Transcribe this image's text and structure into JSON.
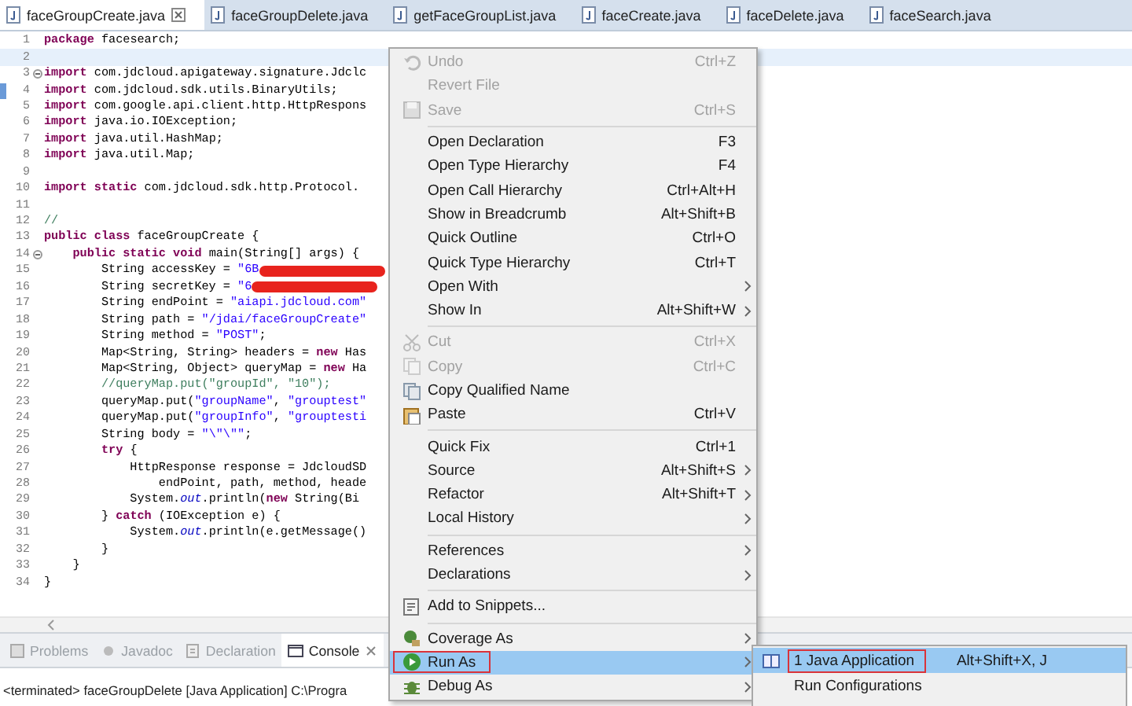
{
  "editor_tabs": [
    {
      "label": "faceGroupCreate.java",
      "selected": true
    },
    {
      "label": "faceGroupDelete.java",
      "selected": false
    },
    {
      "label": "getFaceGroupList.java",
      "selected": false
    },
    {
      "label": "faceCreate.java",
      "selected": false
    },
    {
      "label": "faceDelete.java",
      "selected": false
    },
    {
      "label": "faceSearch.java",
      "selected": false
    }
  ],
  "code_lines": [
    {
      "number": "1",
      "segments": [
        {
          "kind": "keyword",
          "text": "package"
        },
        {
          "kind": "plain",
          "text": " facesearch;"
        }
      ]
    },
    {
      "number": "2",
      "current": true
    },
    {
      "number": "3",
      "fold": true,
      "segments": [
        {
          "kind": "keyword",
          "text": "import"
        },
        {
          "kind": "plain",
          "text": " com.jdcloud.apigateway.signature.Jdclc"
        }
      ]
    },
    {
      "number": "4",
      "marker": true,
      "segments": [
        {
          "kind": "keyword",
          "text": "import"
        },
        {
          "kind": "plain",
          "text": " com.jdcloud.sdk.utils.BinaryUtils;"
        }
      ]
    },
    {
      "number": "5",
      "segments": [
        {
          "kind": "keyword",
          "text": "import"
        },
        {
          "kind": "plain",
          "text": " com.google.api.client.http.HttpRespons"
        }
      ]
    },
    {
      "number": "6",
      "segments": [
        {
          "kind": "keyword",
          "text": "import"
        },
        {
          "kind": "plain",
          "text": " java.io.IOException;"
        }
      ]
    },
    {
      "number": "7",
      "segments": [
        {
          "kind": "keyword",
          "text": "import"
        },
        {
          "kind": "plain",
          "text": " java.util.HashMap;"
        }
      ]
    },
    {
      "number": "8",
      "segments": [
        {
          "kind": "keyword",
          "text": "import"
        },
        {
          "kind": "plain",
          "text": " java.util.Map;"
        }
      ]
    },
    {
      "number": "9"
    },
    {
      "number": "10",
      "segments": [
        {
          "kind": "keyword",
          "text": "import static"
        },
        {
          "kind": "plain",
          "text": " com.jdcloud.sdk.http.Protocol."
        }
      ]
    },
    {
      "number": "11"
    },
    {
      "number": "12",
      "segments": [
        {
          "kind": "comment",
          "text": "//"
        }
      ]
    },
    {
      "number": "13",
      "segments": [
        {
          "kind": "keyword",
          "text": "public class"
        },
        {
          "kind": "plain",
          "text": " faceGroupCreate {"
        }
      ]
    },
    {
      "number": "14",
      "fold": true,
      "segments": [
        {
          "kind": "keyword",
          "text": "    public static void"
        },
        {
          "kind": "plain",
          "text": " main(String[] args) {"
        }
      ]
    },
    {
      "number": "15",
      "segments": [
        {
          "kind": "plain",
          "text": "        String accessKey = "
        },
        {
          "kind": "string",
          "text": "\"6B"
        },
        {
          "kind": "redacted"
        }
      ]
    },
    {
      "number": "16",
      "segments": [
        {
          "kind": "plain",
          "text": "        String secretKey = "
        },
        {
          "kind": "string",
          "text": "\"6"
        },
        {
          "kind": "redacted"
        }
      ]
    },
    {
      "number": "17",
      "segments": [
        {
          "kind": "plain",
          "text": "        String endPoint = "
        },
        {
          "kind": "string",
          "text": "\"aiapi.jdcloud.com\""
        }
      ]
    },
    {
      "number": "18",
      "segments": [
        {
          "kind": "plain",
          "text": "        String path = "
        },
        {
          "kind": "string",
          "text": "\"/jdai/faceGroupCreate\""
        }
      ]
    },
    {
      "number": "19",
      "segments": [
        {
          "kind": "plain",
          "text": "        String method = "
        },
        {
          "kind": "string",
          "text": "\"POST\""
        },
        {
          "kind": "plain",
          "text": ";"
        }
      ]
    },
    {
      "number": "20",
      "segments": [
        {
          "kind": "plain",
          "text": "        Map<String, String> headers = "
        },
        {
          "kind": "keyword",
          "text": "new"
        },
        {
          "kind": "plain",
          "text": " Has"
        }
      ]
    },
    {
      "number": "21",
      "segments": [
        {
          "kind": "plain",
          "text": "        Map<String, Object> queryMap = "
        },
        {
          "kind": "keyword",
          "text": "new"
        },
        {
          "kind": "plain",
          "text": " Ha"
        }
      ]
    },
    {
      "number": "22",
      "segments": [
        {
          "kind": "comment",
          "text": "        //queryMap.put(\"groupId\", \"10\");"
        }
      ]
    },
    {
      "number": "23",
      "segments": [
        {
          "kind": "plain",
          "text": "        queryMap.put("
        },
        {
          "kind": "string",
          "text": "\"groupName\""
        },
        {
          "kind": "plain",
          "text": ", "
        },
        {
          "kind": "string",
          "text": "\"grouptest\""
        }
      ]
    },
    {
      "number": "24",
      "segments": [
        {
          "kind": "plain",
          "text": "        queryMap.put("
        },
        {
          "kind": "string",
          "text": "\"groupInfo\""
        },
        {
          "kind": "plain",
          "text": ", "
        },
        {
          "kind": "string",
          "text": "\"grouptesti"
        }
      ]
    },
    {
      "number": "25",
      "segments": [
        {
          "kind": "plain",
          "text": "        String body = "
        },
        {
          "kind": "string",
          "text": "\"\\\"\\\"\""
        },
        {
          "kind": "plain",
          "text": ";"
        }
      ]
    },
    {
      "number": "26",
      "segments": [
        {
          "kind": "keyword",
          "text": "        try"
        },
        {
          "kind": "plain",
          "text": " {"
        }
      ]
    },
    {
      "number": "27",
      "segments": [
        {
          "kind": "plain",
          "text": "            HttpResponse response = JdcloudSD"
        }
      ]
    },
    {
      "number": "28",
      "segments": [
        {
          "kind": "plain",
          "text": "                endPoint, path, method, heade"
        }
      ]
    },
    {
      "number": "29",
      "segments": [
        {
          "kind": "plain",
          "text": "            System."
        },
        {
          "kind": "field",
          "text": "out"
        },
        {
          "kind": "plain",
          "text": ".println("
        },
        {
          "kind": "keyword",
          "text": "new"
        },
        {
          "kind": "plain",
          "text": " String(Bi"
        }
      ]
    },
    {
      "number": "30",
      "segments": [
        {
          "kind": "plain",
          "text": "        } "
        },
        {
          "kind": "keyword",
          "text": "catch"
        },
        {
          "kind": "plain",
          "text": " (IOException e) {"
        }
      ]
    },
    {
      "number": "31",
      "segments": [
        {
          "kind": "plain",
          "text": "            System."
        },
        {
          "kind": "field",
          "text": "out"
        },
        {
          "kind": "plain",
          "text": ".println(e.getMessage()"
        }
      ]
    },
    {
      "number": "32",
      "segments": [
        {
          "kind": "plain",
          "text": "        }"
        }
      ]
    },
    {
      "number": "33",
      "segments": [
        {
          "kind": "plain",
          "text": "    }"
        }
      ]
    },
    {
      "number": "34",
      "segments": [
        {
          "kind": "plain",
          "text": "}"
        }
      ]
    }
  ],
  "panel_tabs": [
    {
      "label": "Problems",
      "selected": false
    },
    {
      "label": "Javadoc",
      "selected": false
    },
    {
      "label": "Declaration",
      "selected": false
    },
    {
      "label": "Console",
      "selected": true
    }
  ],
  "console": {
    "text": "<terminated> faceGroupDelete [Java Application] C:\\Progra"
  },
  "context_menu": {
    "items": [
      {
        "kind": "item",
        "label": "Undo",
        "shortcut": "Ctrl+Z",
        "disabled": true,
        "selected": false
      },
      {
        "kind": "item",
        "label": "Revert File",
        "disabled": true,
        "selected": false
      },
      {
        "kind": "item",
        "label": "Save",
        "shortcut": "Ctrl+S",
        "disabled": true,
        "selected": false
      },
      {
        "kind": "separator"
      },
      {
        "kind": "item",
        "label": "Open Declaration",
        "shortcut": "F3",
        "disabled": false,
        "selected": false
      },
      {
        "kind": "item",
        "label": "Open Type Hierarchy",
        "shortcut": "F4",
        "disabled": false,
        "selected": false
      },
      {
        "kind": "item",
        "label": "Open Call Hierarchy",
        "shortcut": "Ctrl+Alt+H",
        "disabled": false,
        "selected": false
      },
      {
        "kind": "item",
        "label": "Show in Breadcrumb",
        "shortcut": "Alt+Shift+B",
        "disabled": false,
        "selected": false
      },
      {
        "kind": "item",
        "label": "Quick Outline",
        "shortcut": "Ctrl+O",
        "disabled": false,
        "selected": false
      },
      {
        "kind": "item",
        "label": "Quick Type Hierarchy",
        "shortcut": "Ctrl+T",
        "disabled": false,
        "selected": false
      },
      {
        "kind": "item",
        "label": "Open With",
        "disabled": false,
        "submenu": true,
        "selected": false
      },
      {
        "kind": "item",
        "label": "Show In",
        "shortcut": "Alt+Shift+W",
        "disabled": false,
        "submenu": true,
        "selected": false
      },
      {
        "kind": "separator"
      },
      {
        "kind": "item",
        "label": "Cut",
        "shortcut": "Ctrl+X",
        "disabled": true,
        "selected": false
      },
      {
        "kind": "item",
        "label": "Copy",
        "shortcut": "Ctrl+C",
        "disabled": true,
        "selected": false
      },
      {
        "kind": "item",
        "label": "Copy Qualified Name",
        "disabled": false,
        "selected": false
      },
      {
        "kind": "item",
        "label": "Paste",
        "shortcut": "Ctrl+V",
        "disabled": false,
        "selected": false
      },
      {
        "kind": "separator"
      },
      {
        "kind": "item",
        "label": "Quick Fix",
        "shortcut": "Ctrl+1",
        "disabled": false,
        "selected": false
      },
      {
        "kind": "item",
        "label": "Source",
        "shortcut": "Alt+Shift+S",
        "disabled": false,
        "submenu": true,
        "selected": false
      },
      {
        "kind": "item",
        "label": "Refactor",
        "shortcut": "Alt+Shift+T",
        "disabled": false,
        "submenu": true,
        "selected": false
      },
      {
        "kind": "item",
        "label": "Local History",
        "disabled": false,
        "submenu": true,
        "selected": false
      },
      {
        "kind": "separator"
      },
      {
        "kind": "item",
        "label": "References",
        "disabled": false,
        "submenu": true,
        "selected": false
      },
      {
        "kind": "item",
        "label": "Declarations",
        "disabled": false,
        "submenu": true,
        "selected": false
      },
      {
        "kind": "separator"
      },
      {
        "kind": "item",
        "label": "Add to Snippets...",
        "disabled": false,
        "selected": false
      },
      {
        "kind": "separator"
      },
      {
        "kind": "item",
        "label": "Coverage As",
        "disabled": false,
        "submenu": true,
        "selected": false
      },
      {
        "kind": "item",
        "label": "Run As",
        "disabled": false,
        "submenu": true,
        "selected": true,
        "outlined": true
      },
      {
        "kind": "item",
        "label": "Debug As",
        "disabled": false,
        "submenu": true,
        "selected": false
      }
    ]
  },
  "submenu": {
    "items": [
      {
        "label": "1 Java Application",
        "shortcut": "Alt+Shift+X, J",
        "selected": true,
        "outlined": true
      },
      {
        "label": "Run Configurations",
        "selected": false
      }
    ]
  }
}
